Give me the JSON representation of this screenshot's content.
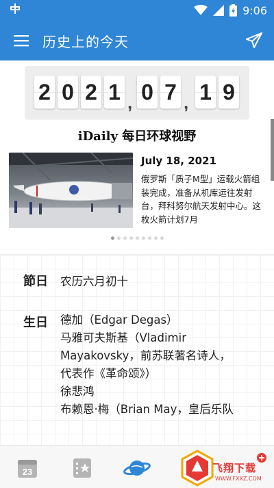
{
  "status_bar": {
    "time": "9:06",
    "left_icon": "app-notification-icon"
  },
  "app_bar": {
    "title": "历史上的今天",
    "menu_icon": "menu-icon",
    "action_icon": "send-icon"
  },
  "date": {
    "digits": [
      "2",
      "0",
      "2",
      "1",
      "0",
      "7",
      "1",
      "9"
    ],
    "separator": ","
  },
  "featured": {
    "title": "iDaily 每日环球视野",
    "date": "July 18, 2021",
    "text": "俄罗斯「质子M型」运载火箭组装完成，准备从机库运往发射台，拜科努尔航天发射中心。这枚火箭计划7月",
    "page_count": 9,
    "active_page": 0
  },
  "info": {
    "festival_label": "節日",
    "festival_value": "农历六月初十",
    "birthday_label": "生日",
    "birthdays": [
      "德加（Edgar Degas）",
      "马雅可夫斯基（Vladimir",
      "Mayakovsky，前苏联著名诗人，",
      "代表作《革命颂》）",
      "徐悲鸿",
      "布赖恩·梅（Brian May，皇后乐队"
    ]
  },
  "bottom_nav": {
    "calendar_day": "23",
    "items": [
      "calendar-icon",
      "favorites-icon",
      "planet-icon",
      "more-icon"
    ]
  },
  "watermark": {
    "text": "飞翔下载",
    "url": "WWW.FXXZ.COM"
  },
  "colors": {
    "primary": "#2f86d6",
    "watermark": "#e53935"
  }
}
